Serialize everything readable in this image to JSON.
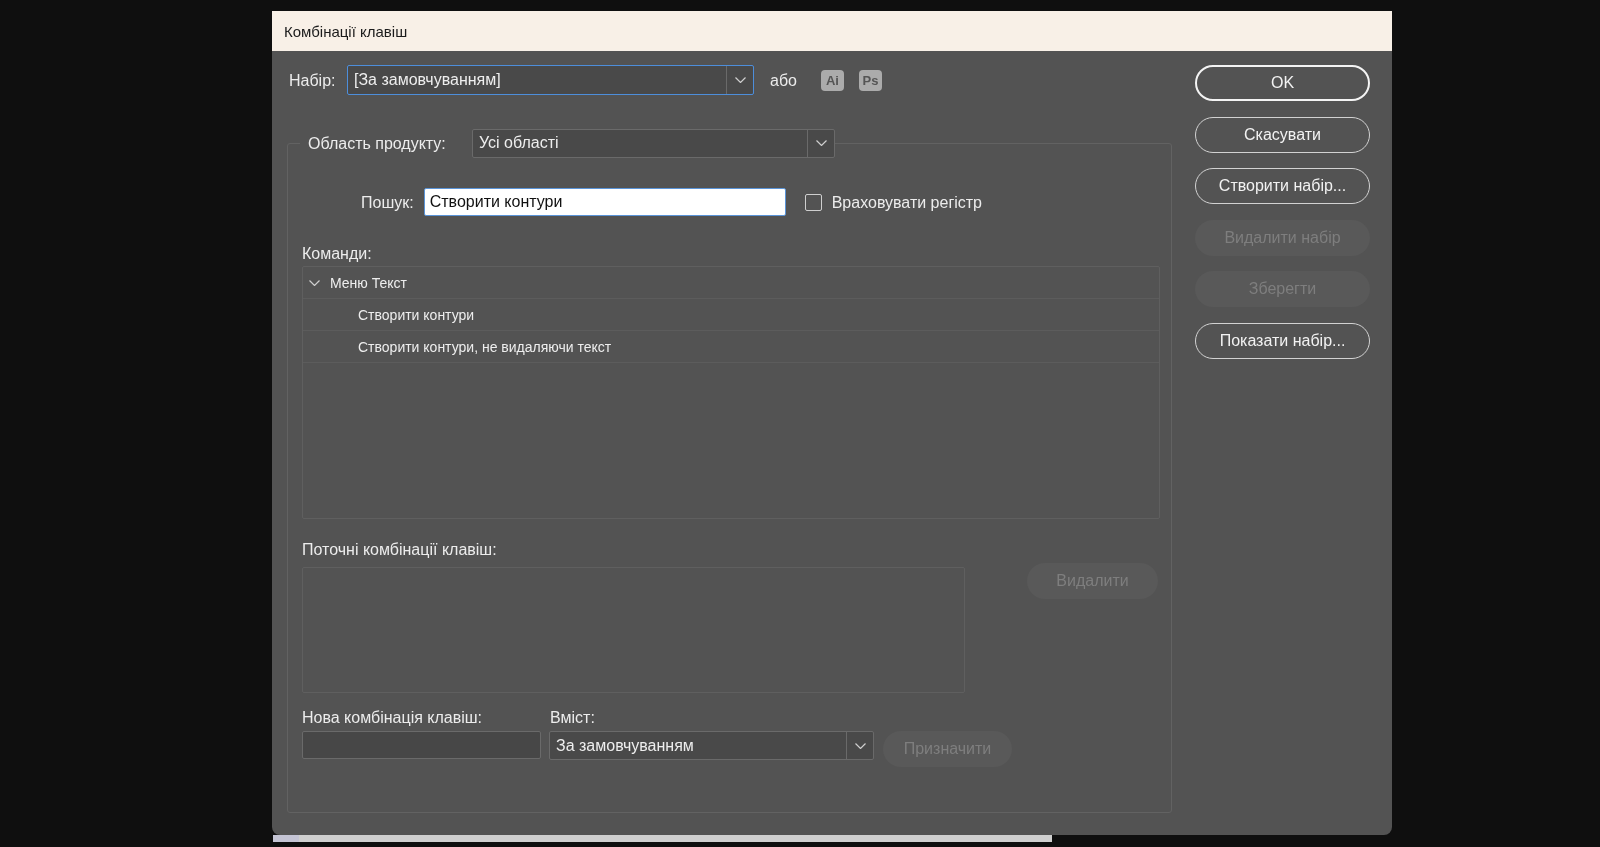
{
  "window": {
    "title": "Комбінації клавіш"
  },
  "set": {
    "label": "Набір:",
    "value": "[За замовчуванням]",
    "focused": true
  },
  "or_label": "або",
  "app_sets": [
    {
      "label": "Ai"
    },
    {
      "label": "Ps"
    }
  ],
  "product_area": {
    "label": "Область продукту:",
    "value": "Усі області"
  },
  "search": {
    "label": "Пошук:",
    "value": "Створити контури",
    "focused": true
  },
  "case_sensitive": {
    "label": "Враховувати регістр",
    "checked": false
  },
  "commands": {
    "label": "Команди:",
    "items": [
      {
        "label": "Меню Текст",
        "expanded": true,
        "children": [
          {
            "label": "Створити контури"
          },
          {
            "label": "Створити контури, не видаляючи текст"
          }
        ]
      }
    ]
  },
  "current_shortcuts": {
    "label": "Поточні комбінації клавіш:",
    "remove_button": {
      "label": "Видалити",
      "disabled": true
    }
  },
  "new_shortcut": {
    "label": "Нова комбінація клавіш:"
  },
  "context": {
    "label": "Вміст:",
    "value": "За замовчуванням"
  },
  "assign_button": {
    "label": "Призначити",
    "disabled": true
  },
  "buttons": [
    {
      "label": "OK",
      "default": true,
      "disabled": false
    },
    {
      "label": "Скасувати",
      "default": false,
      "disabled": false
    },
    {
      "label": "Створити набір...",
      "default": false,
      "disabled": false
    },
    {
      "label": "Видалити набір",
      "default": false,
      "disabled": true
    },
    {
      "label": "Зберегти",
      "default": false,
      "disabled": true
    },
    {
      "label": "Показати набір...",
      "default": false,
      "disabled": false
    }
  ]
}
